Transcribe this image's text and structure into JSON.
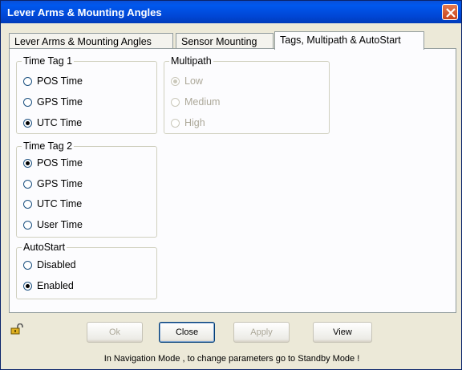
{
  "window": {
    "title": "Lever Arms & Mounting Angles"
  },
  "tabs": [
    {
      "label": "Lever Arms & Mounting Angles"
    },
    {
      "label": "Sensor Mounting"
    },
    {
      "label": "Tags, Multipath & AutoStart"
    }
  ],
  "active_tab": "Tags, Multipath & AutoStart",
  "time_tag_1": {
    "title": "Time Tag 1",
    "options": [
      {
        "label": "POS Time",
        "checked": false
      },
      {
        "label": "GPS Time",
        "checked": false
      },
      {
        "label": "UTC Time",
        "checked": true
      }
    ]
  },
  "time_tag_2": {
    "title": "Time Tag 2",
    "options": [
      {
        "label": "POS Time",
        "checked": true
      },
      {
        "label": "GPS Time",
        "checked": false
      },
      {
        "label": "UTC Time",
        "checked": false
      },
      {
        "label": "User Time",
        "checked": false
      }
    ]
  },
  "autostart": {
    "title": "AutoStart",
    "options": [
      {
        "label": "Disabled",
        "checked": false
      },
      {
        "label": "Enabled",
        "checked": true
      }
    ]
  },
  "multipath": {
    "title": "Multipath",
    "disabled": true,
    "options": [
      {
        "label": "Low",
        "checked": true
      },
      {
        "label": "Medium",
        "checked": false
      },
      {
        "label": "High",
        "checked": false
      }
    ]
  },
  "buttons": {
    "ok": {
      "label": "Ok",
      "enabled": false
    },
    "close": {
      "label": "Close",
      "enabled": true
    },
    "apply": {
      "label": "Apply",
      "enabled": false
    },
    "view": {
      "label": "View",
      "enabled": true
    }
  },
  "status_message": "In Navigation Mode , to change parameters go to Standby Mode !",
  "icons": {
    "close": "close-icon",
    "lock": "unlocked-padlock-icon"
  },
  "colors": {
    "titlebar": "#0054e3",
    "close_button": "#d2532a",
    "radio_checked": "#21a121"
  }
}
